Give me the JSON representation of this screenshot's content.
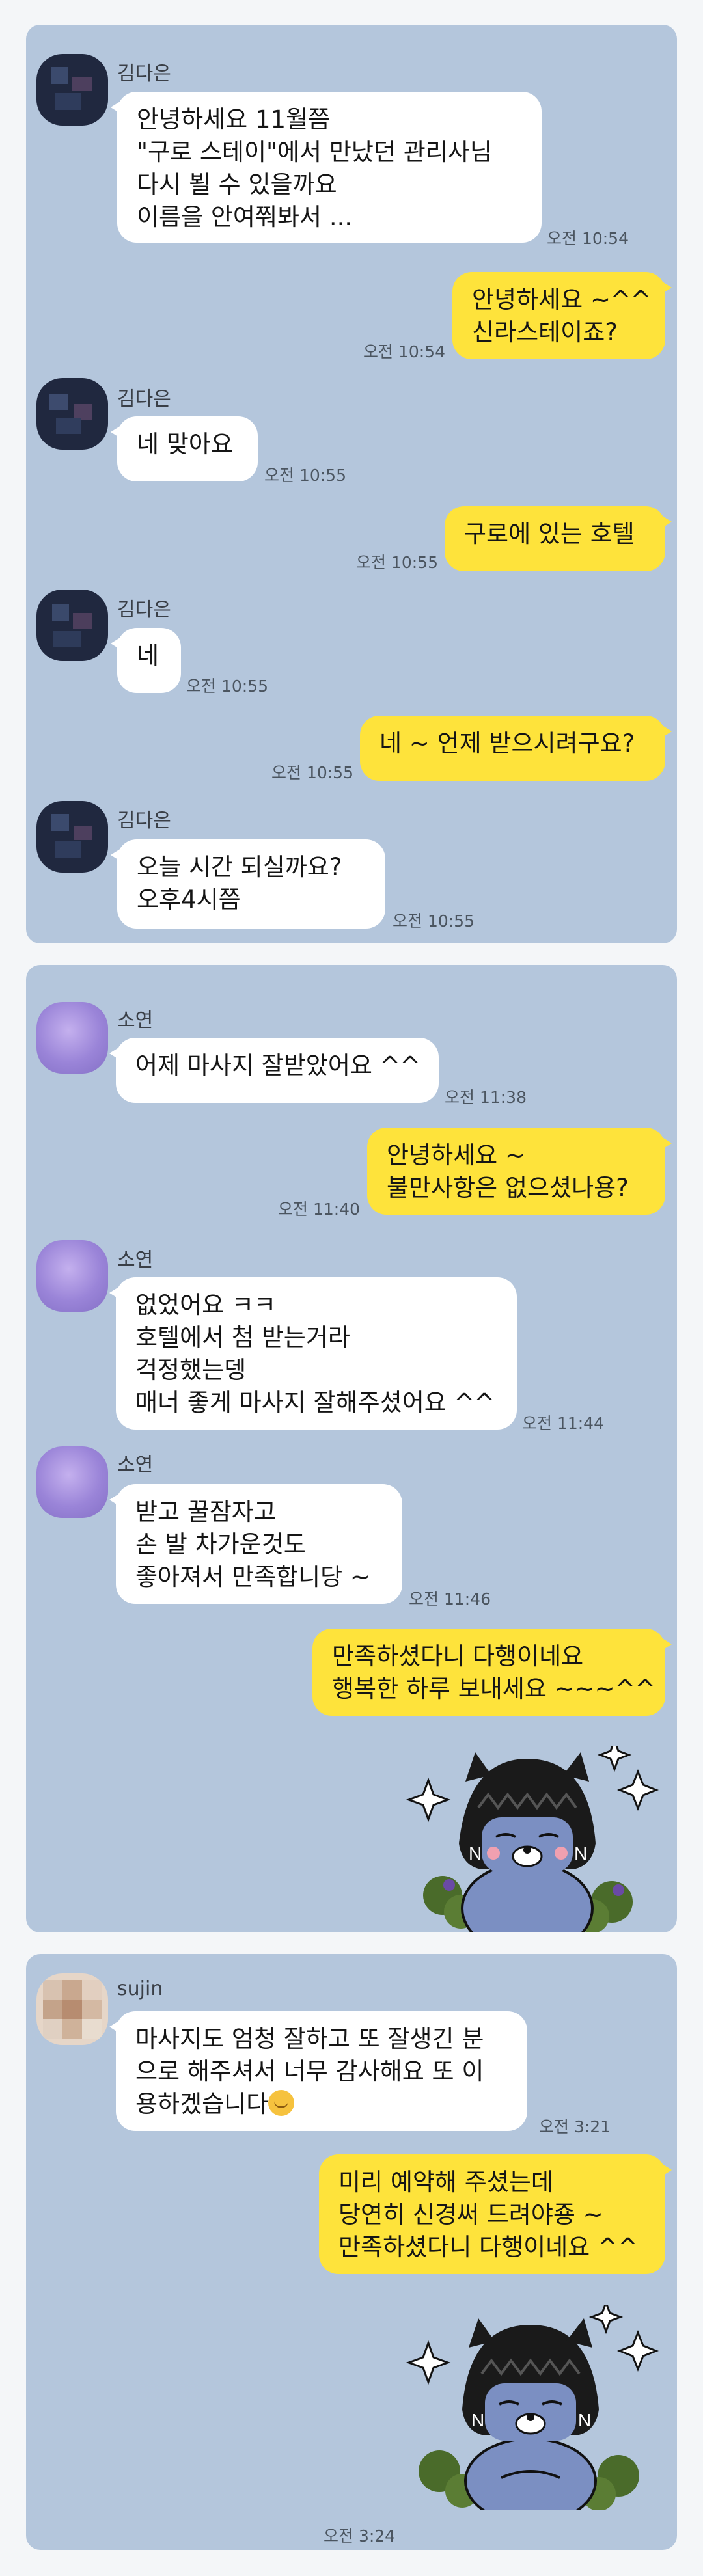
{
  "colors": {
    "chat_background": "#b4c6dc",
    "outgoing_bubble": "#fee33b",
    "incoming_bubble": "#ffffff"
  },
  "panels": [
    {
      "messages": [
        {
          "sender": "김다은",
          "lines": [
            "안녕하세요 11월쯤",
            "\"구로 스테이\"에서 만났던 관리사님",
            "다시 뵐 수 있을까요",
            "이름을 안여쭤봐서 ..."
          ],
          "time": "오전 10:54"
        },
        {
          "lines": [
            "안녕하세요 ~^^",
            "신라스테이죠?"
          ],
          "time": "오전 10:54"
        },
        {
          "sender": "김다은",
          "lines": [
            "네 맞아요"
          ],
          "time": "오전 10:55"
        },
        {
          "lines": [
            "구로에 있는 호텔"
          ],
          "time": "오전 10:55"
        },
        {
          "sender": "김다은",
          "lines": [
            "네"
          ],
          "time": "오전 10:55"
        },
        {
          "lines": [
            "네 ~ 언제 받으시려구요?"
          ],
          "time": "오전 10:55"
        },
        {
          "sender": "김다은",
          "lines": [
            "오늘  시간 되실까요?",
            "오후4시쯤"
          ],
          "time": "오전 10:55"
        }
      ]
    },
    {
      "messages": [
        {
          "sender": "소연",
          "lines": [
            "어제 마사지 잘받았어요 ^^"
          ],
          "time": "오전 11:38"
        },
        {
          "lines": [
            "안녕하세요 ~",
            "불만사항은 없으셨나용?"
          ],
          "time": "오전 11:40"
        },
        {
          "sender": "소연",
          "lines": [
            "없었어요 ㅋㅋ",
            "호텔에서 첨 받는거라",
            "걱정했는뎅",
            "매너 좋게 마사지 잘해주셨어요 ^^"
          ],
          "time": "오전 11:44"
        },
        {
          "sender": "소연",
          "lines": [
            "받고 꿀잠자고",
            "손 발 차가운것도",
            "좋아져서 만족합니당 ~"
          ],
          "time": "오전 11:46"
        },
        {
          "lines": [
            "만족하셨다니 다행이네요",
            "행복한 하루 보내세요 ~~~^^"
          ]
        }
      ],
      "sticker": "character-sticker-icon"
    },
    {
      "messages": [
        {
          "sender": "sujin",
          "lines": [
            "마사지도 엄청 잘하고 또 잘생긴 분",
            "으로 해주셔서 너무 감사해요 또 이",
            "용하겠습니다"
          ],
          "emoji": "smiling-emoji-icon",
          "time": "오전 3:21"
        },
        {
          "lines": [
            "미리 예약해 주셨는데",
            "당연히 신경써 드려야죵 ~",
            "만족하셨다니 다행이네요 ^^"
          ]
        }
      ],
      "sticker": "character-sticker-icon",
      "sticker_time": "오전 3:24"
    }
  ]
}
